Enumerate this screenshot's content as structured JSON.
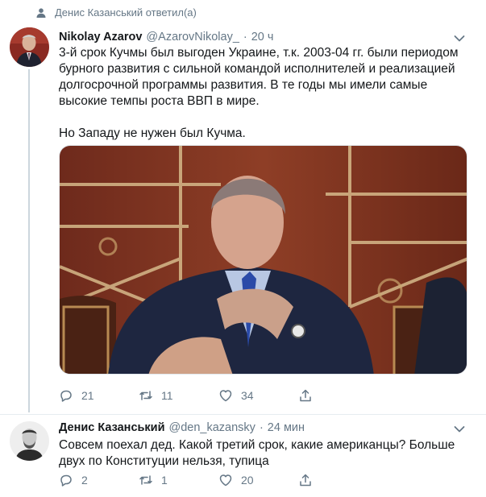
{
  "retweet": {
    "text": "Денис Казанський ответил(а)",
    "icon": "reply-context-icon"
  },
  "tweets": [
    {
      "name": "Nikolay Azarov",
      "handle": "@AzarovNikolay_",
      "time": "20 ч",
      "paragraphs": [
        "3-й срок Кучмы был выгоден Украине, т.к. 2003-04 гг. были периодом бурного развития с сильной командой исполнителей и реализацией долгосрочной программы развития. В те годы мы имели самые высокие темпы роста ВВП в мире.",
        "Но Западу не нужен был Кучма."
      ],
      "actions": {
        "replies": "21",
        "retweets": "11",
        "likes": "34"
      }
    },
    {
      "name": "Денис Казанський",
      "handle": "@den_kazansky",
      "time": "24 мин",
      "paragraphs": [
        "Совсем поехал дед. Какой третий срок, какие американцы? Больше двух по Конституции нельзя, тупица"
      ],
      "actions": {
        "replies": "2",
        "retweets": "1",
        "likes": "20"
      }
    }
  ],
  "colors": {
    "text": "#14171a",
    "muted": "#657786",
    "line": "#ccd6dd"
  }
}
